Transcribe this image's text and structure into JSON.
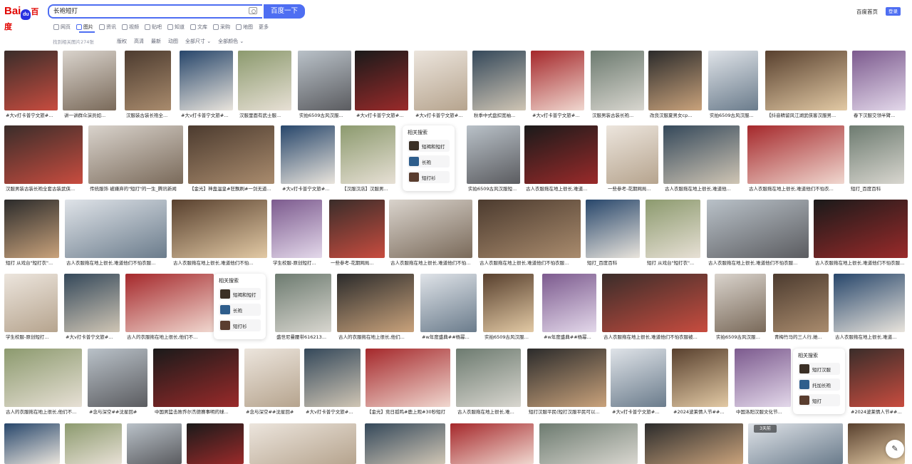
{
  "header": {
    "logo_text_1": "Bai",
    "logo_paw": "du",
    "logo_text_2": "百度",
    "search_value": "长袍短打",
    "search_button": "百度一下",
    "home_link": "百度首页",
    "login_button": "登录"
  },
  "tabs": [
    {
      "label": "网页",
      "icon": "web-icon"
    },
    {
      "label": "图片",
      "icon": "image-icon",
      "active": true
    },
    {
      "label": "资讯",
      "icon": "news-icon"
    },
    {
      "label": "视频",
      "icon": "video-icon"
    },
    {
      "label": "贴吧",
      "icon": "tieba-icon"
    },
    {
      "label": "知道",
      "icon": "zhidao-icon"
    },
    {
      "label": "文库",
      "icon": "wenku-icon"
    },
    {
      "label": "采购",
      "icon": "purchase-icon"
    },
    {
      "label": "地图",
      "icon": "map-icon"
    },
    {
      "label": "更多",
      "icon": ""
    }
  ],
  "result_count": "找到相关图片274张",
  "filters": [
    "版权",
    "高清",
    "最新",
    "动图",
    "全部尺寸 ⌄",
    "全部颜色 ⌄"
  ],
  "related_title": "相关搜索",
  "related_a": [
    "短褐和短打",
    "长袍",
    "短打衫"
  ],
  "related_b": [
    "短打汉服",
    "托加长袍",
    "短打"
  ],
  "captions": {
    "r1": [
      "#大v打卡普宁文旅#...",
      "讲一讲群众演员如...",
      "汉服装古装长袍全...",
      "#大v打卡普宁文旅#...",
      "汉服里面有武士服...",
      "实拍6509古风汉服...",
      "#大v打卡普宁文旅#...",
      "#大v打卡普宁文旅#...",
      "秋季中式盘扣宽袖...",
      "#大v打卡普宁文旅#...",
      "汉服男装古装长袍...",
      "改良汉服夏男女cp...",
      "实拍6509古风汉服...",
      "【抖音精留风江湖武侠客汉服男...",
      "春下汉服交领半臂..."
    ],
    "r2": [
      "汉服男装古装长袍全套古装武侠...",
      "传统服饰 被嫌弃的\"短打\"的一生_腾讯新闻",
      "【金光】神蛊温皇#狂飘刷#一剑无道...",
      "#大v打卡普宁文旅#...",
      "【汉服汉店】汉服男...",
      "实拍6509古风汉服短...",
      "古人衣服拖在地上很长,难道...",
      "一些参考-花期网局...",
      "古人衣服拖在地上很长,难道他...",
      "古人衣服拖在地上很长,难道他们不怕衣...",
      "短打_百度百科"
    ],
    "r3": [
      "短打 从戏台\"短打衣\"...",
      "古人衣服拖在地上很长,难道他们不怕衣服...",
      "古人衣服拖在地上很长,难道他们不怕...",
      "学生校服-原创短打...",
      "一些参考-花期网局...",
      "古人衣服拖在地上很长,难道他们不怕衣服...",
      "古人衣服拖在地上很长,难道他们不怕衣服...",
      "短打_百度百科",
      "短打 从戏台\"短打衣\"...",
      "古人衣服拖在地上很长,难道他们不怕衣服...",
      "古人衣服拖在地上很长,难道他们不怕衣服..."
    ],
    "r4": [
      "学生校服-原创短打...",
      "#大v打卡普宁文旅#...",
      "古人的衣服拖在地上很长,他们不...",
      "盛世尼曼腰带616213...",
      "古人的衣服拖在地上很长,他们...",
      "#w年度盛典##杨幂...",
      "实拍6509古风汉服短...",
      "#w年度盛典##杨幂...",
      "古人衣服拖在地上很长,难道他们不怕衣服被...",
      "实拍6509古风汉服短...",
      "青梅竹马的三人行,她...",
      "古人衣服拖在地上很长,难道..."
    ],
    "r5": [
      "古人的衣服拖在地上很长,他们不...",
      "#念与深空##沈星回#",
      "中国男篮击败乔尔杰德赛事明的球...",
      "#念与深空##沈星回#",
      "#大v打卡普宁文旅#...",
      "【金光】竞日孤鸣#鹿上观#30秒短打",
      "古人衣服拖在地上很长,难...",
      "短打汉服平民(短打汉服平民可以...",
      "#大v打卡普宁文旅#...",
      "#2024波莱情人节##...",
      "中国洛阳汉服文化节...",
      "#2024波莱情人节##..."
    ]
  },
  "age_badge": "3天前",
  "colors": {
    "accent": "#4e6ef2",
    "logo_red": "#e10602",
    "logo_blue": "#2932e1"
  }
}
